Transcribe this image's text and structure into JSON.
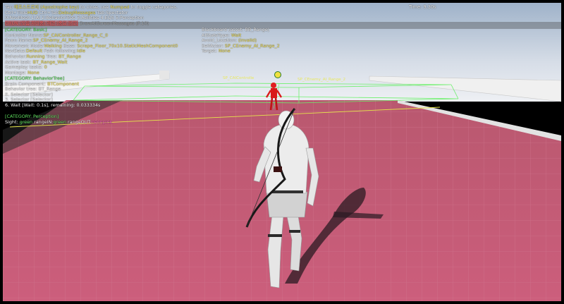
{
  "hud": {
    "header": {
      "line1_prefix": "Tap ",
      "line1_key": "애포스트로피 (Apostrophe key)",
      "line1_mid": " to close, use ",
      "line1_numpad": "Numpad",
      "line1_suffix": " to toggle categories.",
      "line2_a": "Ctrl+Tilde",
      "line2_b": "HUD",
      "line2_c": " Ctrl+Tab",
      "line2_d": "DebugMessages",
      "line2_e": " Tab",
      "line2_f": ":Spectator",
      "line3": "0:NavMesh 1:AI 2:BehaviorTree 3:Abilities 4:EQS 5:Perception",
      "line4_tag": "GRUN (모름 처리중) 재현 (중요 경로)",
      "line4_tail": "DrawAllScreenMessages (F:10)"
    },
    "time": "Time: 9.30s",
    "basic": {
      "category": "[CATEGORY: Basic]",
      "controller_label": "Controller Name:",
      "controller_value": "SP_CAIController_Range_C_0",
      "pawn_label": "Pawn Name:",
      "pawn_value": "SP_CEnemy_AI_Range_2",
      "movement_label": "Movement Mode:",
      "movement_value": "Walking",
      "movement_base_label": " Base: ",
      "movement_base_value": "Scrape_Floor_70x10.StaticMeshComponent0",
      "navdata_label": "NavData:",
      "navdata_value": "Default",
      "path_label": " Path following:",
      "path_value": "Idle",
      "behavior_label": "Behavior:",
      "behavior_value": "Running",
      "tree_label": " Tree: ",
      "tree_value": "BT_Range",
      "active_task_label": "Active task: ",
      "active_task_value": "BT_Range_Wait",
      "gameplay_tasks_label": "Gameplay tasks: ",
      "gameplay_tasks_value": "0",
      "montage_label": "Montage: ",
      "montage_value": "None"
    },
    "blackboard": {
      "title": "Blackboard (asset: BB_Range)",
      "ai_state_label": "AIStateType: ",
      "ai_state_value": "Wait",
      "avoid_label": "Avoid_Location: ",
      "avoid_value": "(invalid)",
      "self_actor_label": "SelfActor: ",
      "self_actor_value": "SP_CEnemy_AI_Range_2",
      "target_label": "Target: ",
      "target_value": "None"
    },
    "bt": {
      "category": "[CATEGORY: BehaviorTree]",
      "brain_label": "Brain Component: ",
      "brain_value": "BTComponent",
      "tree_line": "Behavior tree: BT_Range",
      "node1": " 0. Selector [Selector]",
      "node2": " 3. Selector [Selector]",
      "node3": " 6. Wait [Wait: 0.1s], remaining: 0.033334s"
    },
    "perception": {
      "category": "[CATEGORY: Perception]",
      "sight_label": "Sight: ",
      "sight_green": "green",
      "sight_in": " rangeIN:",
      "sight_in_value": "green",
      "sight_out": " rangeOUT:",
      "sight_out_value": "neonpink"
    }
  },
  "world": {
    "enemy_tag_a": "SP_CAIControlle",
    "enemy_tag_b": "SP_CEnemy_AI_Range_2"
  },
  "colors": {
    "floor": "#c45a77",
    "sky_top": "#9fb4cc",
    "sky_bottom": "#e6eaf0",
    "wall": "#eeeeee",
    "enemy": "#e02020",
    "debug_green": "#6cf06c",
    "debug_yellow": "#e6e64a"
  }
}
